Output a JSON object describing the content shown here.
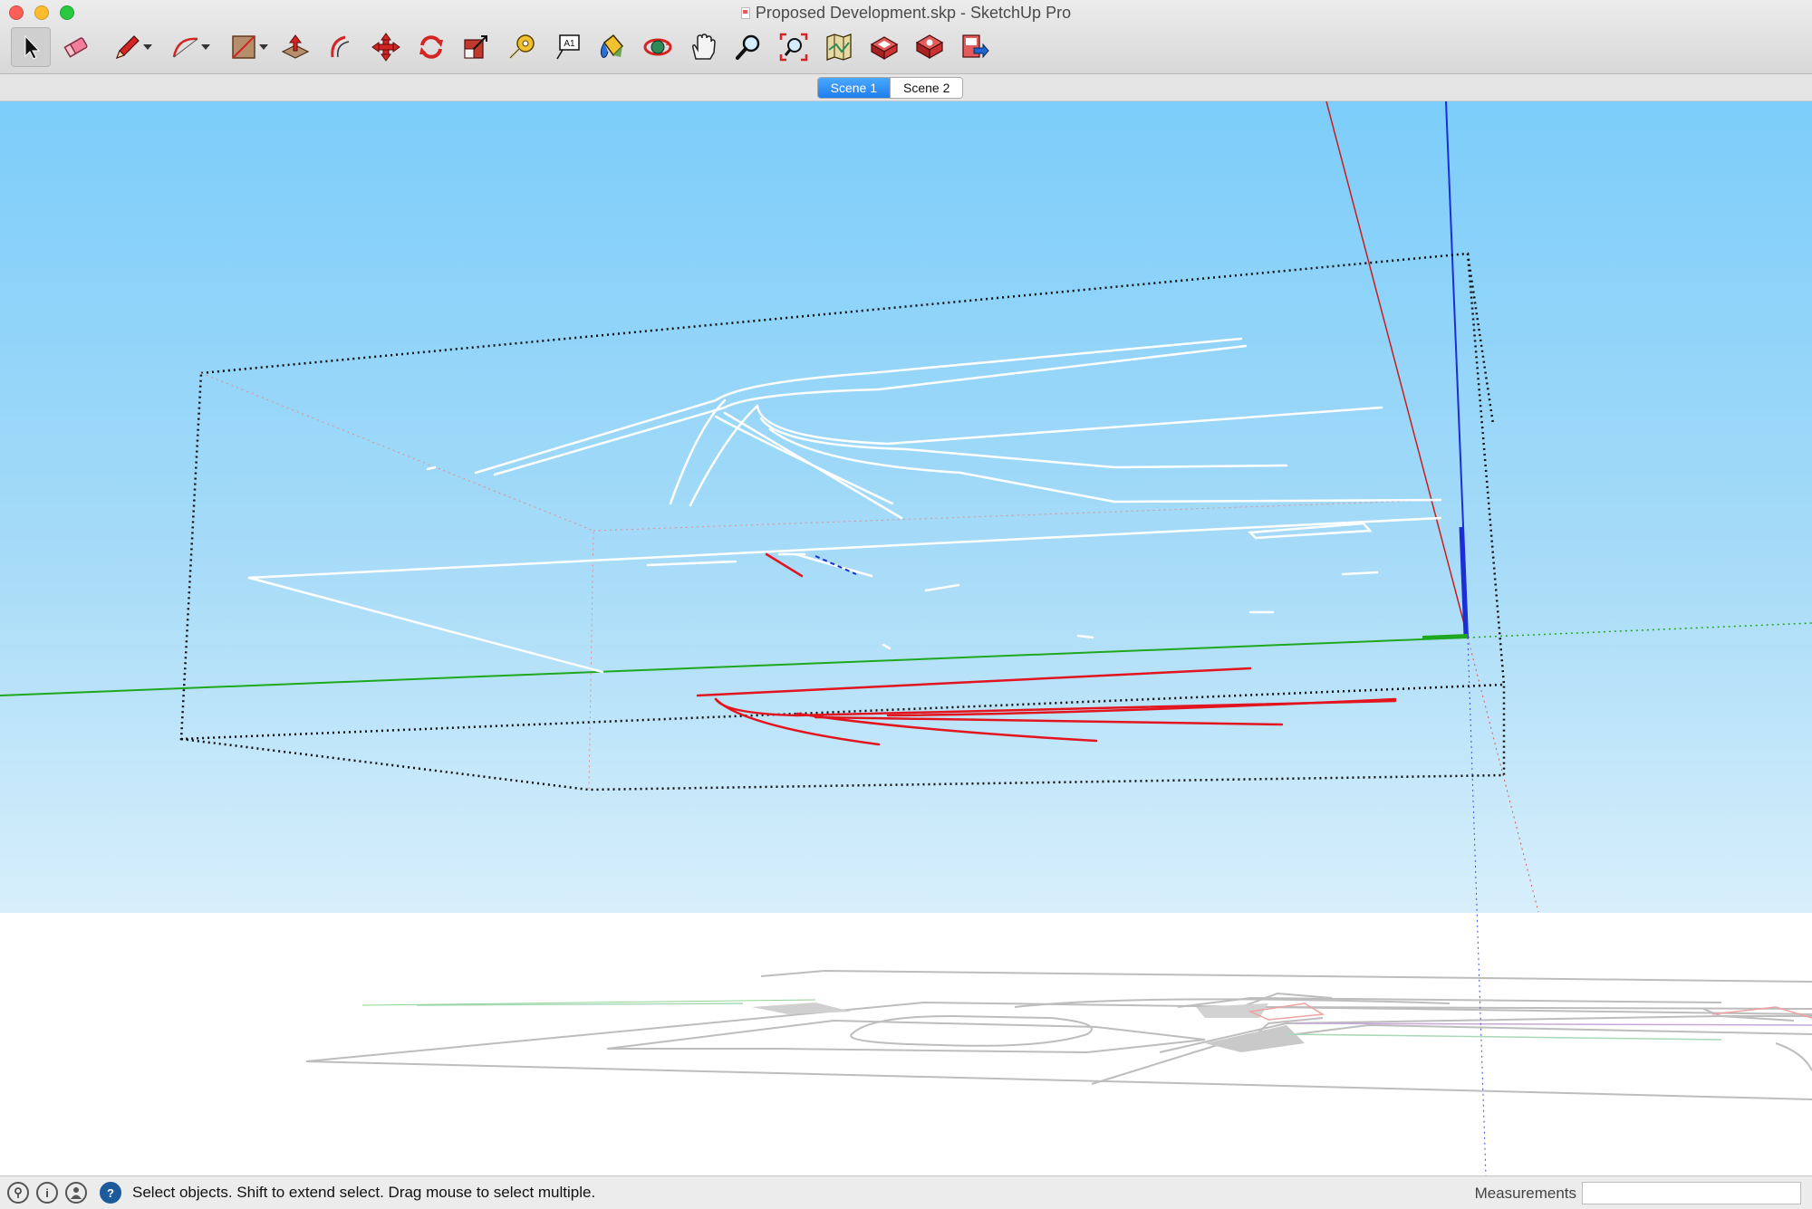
{
  "window": {
    "title": "Proposed Development.skp - SketchUp Pro",
    "buttons": {
      "close": "close",
      "minimize": "minimize",
      "maximize": "zoom"
    }
  },
  "toolbar": {
    "tools": [
      {
        "name": "select",
        "icon": "arrow-cursor-icon"
      },
      {
        "name": "eraser",
        "icon": "eraser-icon"
      },
      {
        "name": "line",
        "icon": "pencil-icon",
        "dropdown": true
      },
      {
        "name": "arc",
        "icon": "arc-icon",
        "dropdown": true
      },
      {
        "name": "rectangle",
        "icon": "rectangle-icon",
        "dropdown": true
      },
      {
        "name": "push-pull",
        "icon": "push-pull-icon"
      },
      {
        "name": "offset",
        "icon": "offset-icon"
      },
      {
        "name": "move",
        "icon": "move-icon"
      },
      {
        "name": "rotate",
        "icon": "rotate-icon"
      },
      {
        "name": "scale",
        "icon": "scale-icon"
      },
      {
        "name": "tape-measure",
        "icon": "tape-measure-icon"
      },
      {
        "name": "text",
        "icon": "text-icon"
      },
      {
        "name": "paint-bucket",
        "icon": "paint-bucket-icon"
      },
      {
        "name": "orbit",
        "icon": "orbit-icon"
      },
      {
        "name": "pan",
        "icon": "hand-icon"
      },
      {
        "name": "zoom",
        "icon": "magnifier-icon"
      },
      {
        "name": "zoom-extents",
        "icon": "zoom-extents-icon"
      },
      {
        "name": "add-location",
        "icon": "map-icon"
      },
      {
        "name": "3d-warehouse",
        "icon": "warehouse-icon"
      },
      {
        "name": "extension-warehouse",
        "icon": "extension-icon"
      },
      {
        "name": "send-to-layout",
        "icon": "layout-icon"
      }
    ],
    "text_tool_glyph": "A1"
  },
  "scenes": {
    "tabs": [
      {
        "label": "Scene 1",
        "active": true
      },
      {
        "label": "Scene 2",
        "active": false
      }
    ]
  },
  "viewport": {
    "sky_color_top": "#7ccdfa",
    "sky_color_horizon": "#d8effb",
    "ground_color": "#ffffff",
    "axis_colors": {
      "red": "#d21a1a",
      "green": "#1fa81f",
      "blue": "#1b2fd6"
    },
    "edge_color_selected": "#ffffff",
    "bounding_box_color": "#111111"
  },
  "status_bar": {
    "message": "Select objects. Shift to extend select. Drag mouse to select multiple.",
    "help_icon_glyph": "?",
    "info_icon_glyph": "i",
    "geo_icon_glyph": "⚲"
  },
  "measurements": {
    "label": "Measurements",
    "value": ""
  }
}
